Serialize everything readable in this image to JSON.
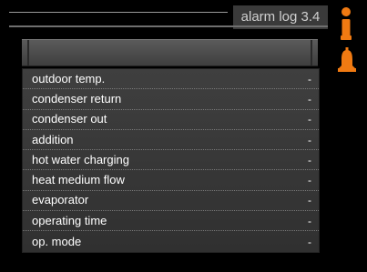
{
  "header": {
    "title": "alarm log 3.4"
  },
  "list": {
    "rows": [
      {
        "label": "outdoor temp.",
        "value": "-"
      },
      {
        "label": "condenser return",
        "value": "-"
      },
      {
        "label": "condenser out",
        "value": "-"
      },
      {
        "label": "addition",
        "value": "-"
      },
      {
        "label": "hot water charging",
        "value": "-"
      },
      {
        "label": "heat medium flow",
        "value": "-"
      },
      {
        "label": "evaporator",
        "value": "-"
      },
      {
        "label": "operating time",
        "value": "-"
      },
      {
        "label": "op. mode",
        "value": "-"
      }
    ]
  },
  "icons": {
    "info": "info-icon",
    "alarm": "alarm-bell-icon",
    "accent_color": "#f07a12"
  }
}
